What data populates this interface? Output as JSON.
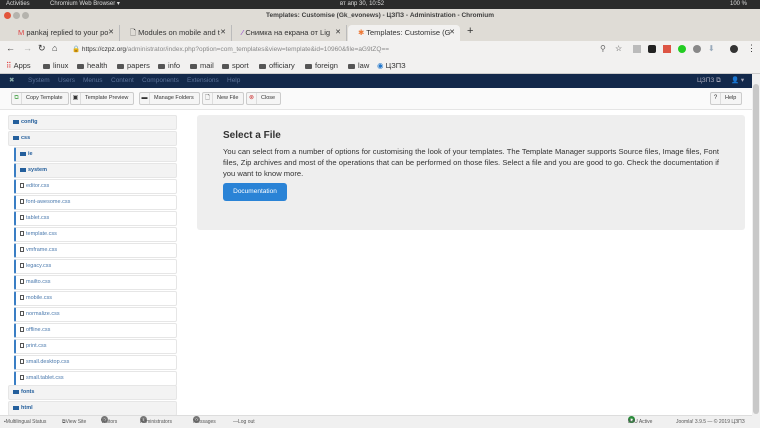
{
  "os": {
    "activities": "Activities",
    "app": "Chromium Web Browser ▾",
    "clock": "вт апр 30, 10:52",
    "battery": "100 %"
  },
  "window": {
    "title": "Templates: Customise (Gk_evonews) - ЦЗПЗ - Administration - Chromium"
  },
  "tabs": [
    {
      "label": "pankaj replied to your po"
    },
    {
      "label": "Modules on mobile and t"
    },
    {
      "label": "Снимка на екрана от Lig"
    },
    {
      "label": "Templates: Customise (G"
    }
  ],
  "address": {
    "domain": "https://czpz.org",
    "path": "/administrator/index.php?option=com_templates&view=template&id=10960&file=aG9tZQ=="
  },
  "bookmarks": [
    "Apps",
    "linux",
    "health",
    "papers",
    "info",
    "mail",
    "sport",
    "officiary",
    "foreign",
    "law",
    "ЦЗПЗ"
  ],
  "nav": {
    "items": [
      "System",
      "Users",
      "Menus",
      "Content",
      "Components",
      "Extensions",
      "Help"
    ],
    "site": "ЦЗПЗ ⧉",
    "user": "👤 ▾"
  },
  "toolbar": {
    "copy": "Copy Template",
    "preview": "Template Preview",
    "folders": "Manage Folders",
    "newfile": "New File",
    "close": "Close",
    "help": "Help"
  },
  "tree": {
    "top": [
      "config",
      "css"
    ],
    "sub": [
      "ie",
      "system"
    ],
    "files": [
      "editor.css",
      "font-awesome.css",
      "tablet.css",
      "template.css",
      "vmframe.css",
      "legacy.css",
      "mailto.css",
      "mobile.css",
      "normalize.css",
      "offline.css",
      "print.css",
      "small.desktop.css",
      "small.tablet.css"
    ],
    "bottom": [
      "fonts",
      "html"
    ]
  },
  "main": {
    "title": "Select a File",
    "text": "You can select from a number of options for customising the look of your templates. The Template Manager supports Source files, Image files, Font files, Zip archives and most of the operations that can be performed on those files. Select a file and you are good to go. Check the documentation if you want to know more.",
    "button": "Documentation"
  },
  "status": {
    "multilingual": "Multilingual Status",
    "viewsite": "View Site",
    "visitors": "Visitors",
    "visitors_count": "0",
    "admins": "Administrators",
    "admins_count": "1",
    "messages": "Messages",
    "messages_count": "0",
    "logout": "Log out",
    "bou": "BoU Active",
    "version": "Joomla! 3.9.5 — © 2019 ЦЗПЗ"
  }
}
